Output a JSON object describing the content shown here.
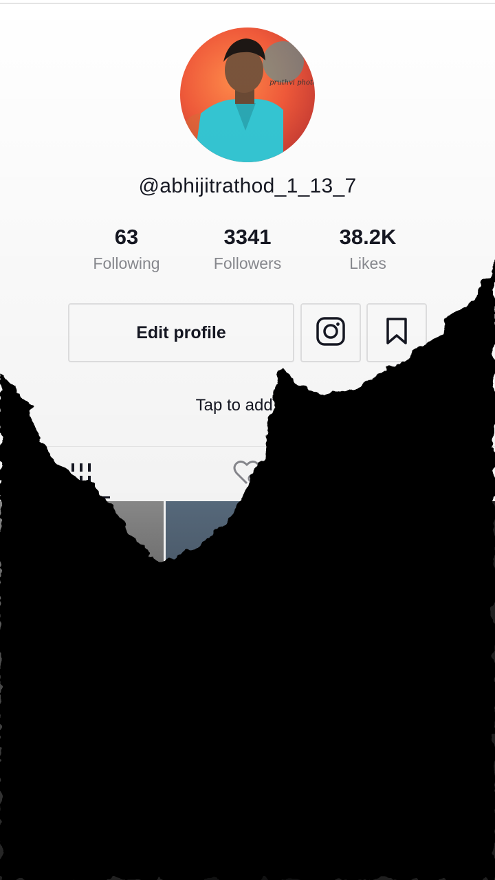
{
  "profile": {
    "username": "@abhijitrathod_1_13_7",
    "avatar_watermark": "pruthvi photogr"
  },
  "stats": {
    "following": {
      "value": "63",
      "label": "Following"
    },
    "followers": {
      "value": "3341",
      "label": "Followers"
    },
    "likes": {
      "value": "38.2K",
      "label": "Likes"
    }
  },
  "actions": {
    "edit_label": "Edit profile",
    "instagram_icon": "instagram-icon",
    "bookmark_icon": "bookmark-icon"
  },
  "bio": {
    "hint": "Tap to add bio"
  },
  "tabs": {
    "videos_icon": "grid-icon",
    "liked_icon": "liked-hidden-icon"
  },
  "colors": {
    "text_primary": "#161823",
    "text_secondary": "#8a8b91",
    "border": "#e3e3e4",
    "overlay": "#000000"
  }
}
